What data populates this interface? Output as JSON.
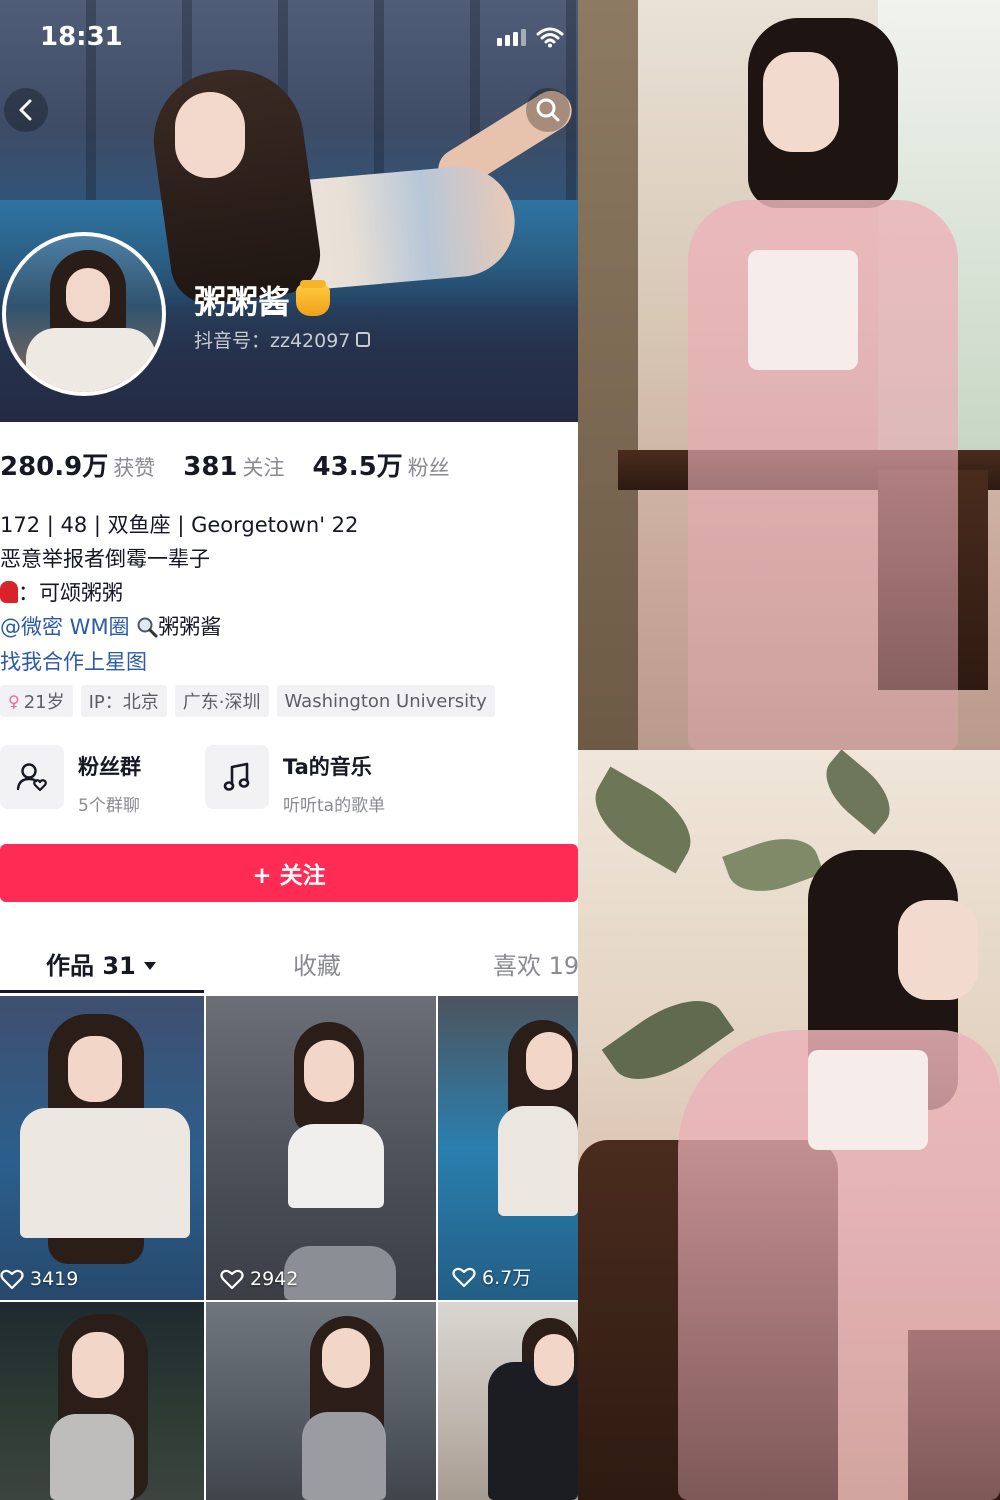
{
  "status_bar": {
    "time": "18:31"
  },
  "profile": {
    "nickname": "粥粥酱",
    "douyin_id": "抖音号：zz42097",
    "stats": [
      {
        "value": "280.9万",
        "label": "获赞"
      },
      {
        "value": "381",
        "label": "关注"
      },
      {
        "value": "43.5万",
        "label": "粉丝"
      }
    ],
    "bio": {
      "line1": "172 | 48 | 双鱼座 | Georgetown' 22",
      "line2": "恶意举报者倒霉一辈子",
      "line3": "：可颂粥粥",
      "line4_mention": "@微密 WM圈",
      "line4_text": "粥粥酱",
      "line5": "找我合作上星图"
    },
    "tags": [
      "21岁",
      "IP：北京",
      "广东·深圳",
      "Washington University"
    ],
    "entries": [
      {
        "title": "粉丝群",
        "subtitle": "5个群聊",
        "icon": "fan-group-icon"
      },
      {
        "title": "Ta的音乐",
        "subtitle": "听听ta的歌单",
        "icon": "music-note-icon"
      }
    ],
    "follow_button": "+ 关注"
  },
  "tabs": {
    "works": "作品 31",
    "favorites": "收藏",
    "likes": "喜欢 19"
  },
  "videos": [
    {
      "likes": "3419"
    },
    {
      "likes": "2942"
    },
    {
      "likes": "6.7万"
    },
    {
      "likes": ""
    },
    {
      "likes": ""
    },
    {
      "likes": ""
    }
  ],
  "colors": {
    "follow": "#fe2c55",
    "link": "#2c5aa8",
    "muted": "#8a8b91"
  }
}
